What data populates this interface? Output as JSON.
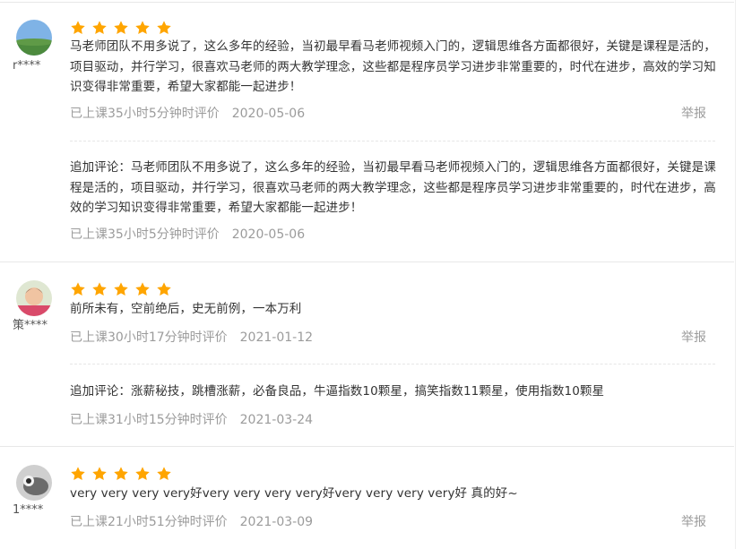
{
  "reviews": [
    {
      "username": "r****",
      "rating": 5,
      "content": "马老师团队不用多说了，这么多年的经验，当初最早看马老师视频入门的，逻辑思维各方面都很好，关键是课程是活的，项目驱动，并行学习，很喜欢马老师的两大教学理念，这些都是程序员学习进步非常重要的，时代在进步，高效的学习知识变得非常重要，希望大家都能一起进步！",
      "meta": "已上课35小时5分钟时评价",
      "date": "2020-05-06",
      "report_label": "举报",
      "followup": {
        "content": "追加评论：马老师团队不用多说了，这么多年的经验，当初最早看马老师视频入门的，逻辑思维各方面都很好，关键是课程是活的，项目驱动，并行学习，很喜欢马老师的两大教学理念，这些都是程序员学习进步非常重要的，时代在进步，高效的学习知识变得非常重要，希望大家都能一起进步！",
        "meta": "已上课35小时5分钟时评价",
        "date": "2020-05-06"
      }
    },
    {
      "username": "策****",
      "rating": 5,
      "content": "前所未有，空前绝后，史无前例，一本万利",
      "meta": "已上课30小时17分钟时评价",
      "date": "2021-01-12",
      "report_label": "举报",
      "followup": {
        "content": "追加评论：涨薪秘技，跳槽涨薪，必备良品，牛逼指数10颗星，搞笑指数11颗星，使用指数10颗星",
        "meta": "已上课31小时15分钟时评价",
        "date": "2021-03-24"
      }
    },
    {
      "username": "1****",
      "rating": 5,
      "content": "very very very very好very very very very好very very very very好 真的好~",
      "meta": "已上课21小时51分钟时评价",
      "date": "2021-03-09",
      "report_label": "举报"
    }
  ],
  "colors": {
    "star": "#ffa500",
    "muted_text": "#9b9b9b",
    "body_text": "#333333"
  }
}
